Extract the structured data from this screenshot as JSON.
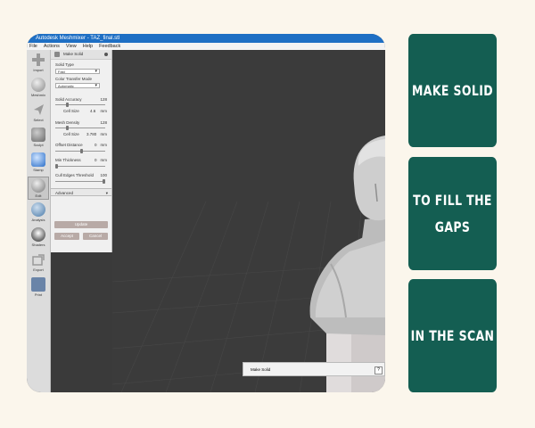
{
  "window": {
    "title": "Autodesk Meshmixer - TAZ_final.stl"
  },
  "menu": [
    "File",
    "Actions",
    "View",
    "Help",
    "Feedback"
  ],
  "tools": [
    {
      "label": "Import",
      "icon": "plus-icon"
    },
    {
      "label": "Meshmix",
      "icon": "meshmix-icon"
    },
    {
      "label": "Select",
      "icon": "select-arrow-icon"
    },
    {
      "label": "Sculpt",
      "icon": "brush-icon"
    },
    {
      "label": "Stamp",
      "icon": "stamp-icon"
    },
    {
      "label": "Edit",
      "icon": "edit-icon"
    },
    {
      "label": "Analysis",
      "icon": "analysis-icon"
    },
    {
      "label": "Shaders",
      "icon": "shaders-icon"
    },
    {
      "label": "Export",
      "icon": "export-icon"
    },
    {
      "label": "Print",
      "icon": "print-icon"
    }
  ],
  "panel": {
    "title": "Make Solid",
    "solid_type_label": "Solid Type",
    "solid_type_value": "Fast",
    "color_mode_label": "Color Transfer Mode",
    "color_mode_value": "Automatic",
    "solid_accuracy_label": "Solid Accuracy",
    "solid_accuracy_value": "128",
    "cell_size_label": "Cell Size",
    "cell_size_value": "4.6",
    "cell_size_unit": "mm",
    "mesh_density_label": "Mesh Density",
    "mesh_density_value": "128",
    "cell_size2_label": "Cell Size",
    "cell_size2_value": "3.780",
    "cell_size2_unit": "mm",
    "offset_label": "Offset Distance",
    "offset_value": "0",
    "offset_unit": "mm",
    "min_thick_label": "Min Thickness",
    "min_thick_value": "0",
    "min_thick_unit": "mm",
    "cull_label": "Cull Edges Threshold",
    "cull_value": "100",
    "advanced_label": "Advanced",
    "update_label": "Update",
    "accept_label": "Accept",
    "cancel_label": "Cancel"
  },
  "toast": {
    "text": "Make Solid",
    "help": "?"
  },
  "tiles": [
    {
      "text": "MAKE SOLID"
    },
    {
      "text": "TO FILL THE\nGAPS"
    },
    {
      "text": "IN THE SCAN"
    }
  ],
  "colors": {
    "tile_bg": "#145e52",
    "background": "#fbf6ec",
    "titlebar": "#1e6fc4",
    "viewport": "#3b3b3b"
  }
}
